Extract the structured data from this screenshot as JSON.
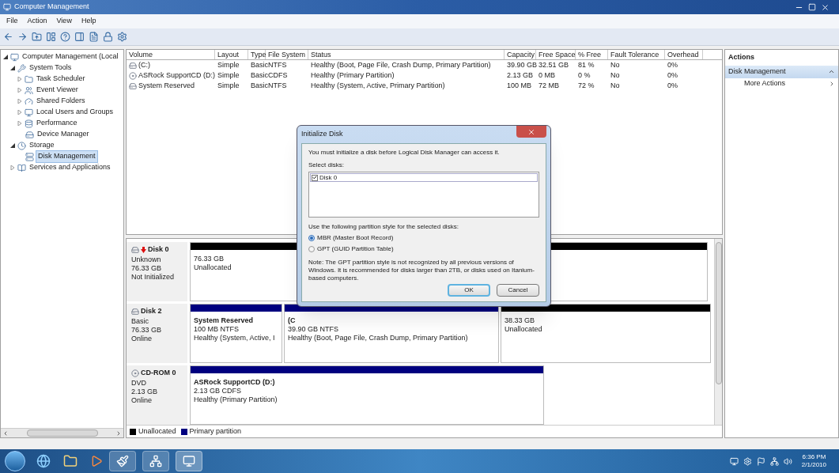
{
  "window": {
    "title": "Computer Management"
  },
  "menu": [
    "File",
    "Action",
    "View",
    "Help"
  ],
  "tree": [
    {
      "label": "Computer Management (Local",
      "expanded": true,
      "selected": false,
      "children": [
        {
          "label": "System Tools",
          "expanded": true,
          "selected": false,
          "children": [
            {
              "label": "Task Scheduler",
              "expanded": false,
              "selected": false
            },
            {
              "label": "Event Viewer",
              "expanded": false,
              "selected": false
            },
            {
              "label": "Shared Folders",
              "expanded": false,
              "selected": false
            },
            {
              "label": "Local Users and Groups",
              "expanded": false,
              "selected": false
            },
            {
              "label": "Performance",
              "expanded": false,
              "selected": false
            },
            {
              "label": "Device Manager",
              "selected": false
            }
          ]
        },
        {
          "label": "Storage",
          "expanded": true,
          "selected": false,
          "children": [
            {
              "label": "Disk Management",
              "selected": true
            }
          ]
        },
        {
          "label": "Services and Applications",
          "expanded": false,
          "selected": false
        }
      ]
    }
  ],
  "volumes": {
    "columns": [
      "Volume",
      "Layout",
      "Type",
      "File System",
      "Status",
      "Capacity",
      "Free Space",
      "% Free",
      "Fault Tolerance",
      "Overhead"
    ],
    "rows": [
      {
        "kind": "disk",
        "cells": [
          "(C:)",
          "Simple",
          "Basic",
          "NTFS",
          "Healthy (Boot, Page File, Crash Dump, Primary Partition)",
          "39.90 GB",
          "32.51 GB",
          "81 %",
          "No",
          "0%"
        ]
      },
      {
        "kind": "cdrom",
        "cells": [
          "ASRock SupportCD (D:)",
          "Simple",
          "Basic",
          "CDFS",
          "Healthy (Primary Partition)",
          "2.13 GB",
          "0 MB",
          "0 %",
          "No",
          "0%"
        ]
      },
      {
        "kind": "disk",
        "cells": [
          "System Reserved",
          "Simple",
          "Basic",
          "NTFS",
          "Healthy (System, Active, Primary Partition)",
          "100 MB",
          "72 MB",
          "72 %",
          "No",
          "0%"
        ]
      }
    ]
  },
  "disks": [
    {
      "kind": "disk",
      "alert": true,
      "name": "Disk 0",
      "lines": [
        "Unknown",
        "76.33 GB",
        "Not Initialized"
      ],
      "partitions": [
        {
          "kind": "unallocated",
          "lines": [
            "76.33 GB",
            "Unallocated"
          ]
        }
      ]
    },
    {
      "kind": "disk",
      "alert": false,
      "name": "Disk 2",
      "lines": [
        "Basic",
        "76.33 GB",
        "Online"
      ],
      "partitions": [
        {
          "kind": "primary",
          "label": "System Reserved",
          "lines": [
            "100 MB NTFS",
            "Healthy (System, Active, I"
          ]
        },
        {
          "kind": "primary",
          "label": "(C",
          "lines": [
            "39.90 GB NTFS",
            "Healthy (Boot, Page File, Crash Dump, Primary Partition)"
          ]
        },
        {
          "kind": "unallocated",
          "lines": [
            "38.33 GB",
            "Unallocated"
          ]
        }
      ]
    },
    {
      "kind": "cdrom",
      "alert": false,
      "name": "CD-ROM 0",
      "lines": [
        "DVD",
        "2.13 GB",
        "Online"
      ],
      "partitions": [
        {
          "kind": "primary",
          "label": "ASRock SupportCD  (D:)",
          "lines": [
            "2.13 GB CDFS",
            "Healthy (Primary Partition)"
          ]
        }
      ]
    }
  ],
  "legend": [
    {
      "label": "Unallocated",
      "color": "#000000"
    },
    {
      "label": "Primary partition",
      "color": "#00007f"
    }
  ],
  "actions": {
    "title": "Actions",
    "section": {
      "label": "Disk Management",
      "expanded": true
    },
    "items": [
      "More Actions"
    ]
  },
  "dialog": {
    "title": "Initialize Disk",
    "message": "You must initialize a disk before Logical Disk Manager can access it.",
    "select_label": "Select disks:",
    "disks": [
      {
        "label": "Disk 0",
        "checked": true
      }
    ],
    "style_label": "Use the following partition style for the selected disks:",
    "options": [
      {
        "label": "MBR (Master Boot Record)",
        "selected": true
      },
      {
        "label": "GPT (GUID Partition Table)",
        "selected": false
      }
    ],
    "note": "Note: The GPT partition style is not recognized by all previous versions of Windows. It is recommended for disks larger than 2TB, or disks used on Itanium-based computers.",
    "buttons": [
      {
        "label": "OK",
        "default": true
      },
      {
        "label": "Cancel",
        "default": false
      }
    ]
  },
  "taskbar": {
    "time": "6:36 PM",
    "date": "2/1/2010"
  }
}
